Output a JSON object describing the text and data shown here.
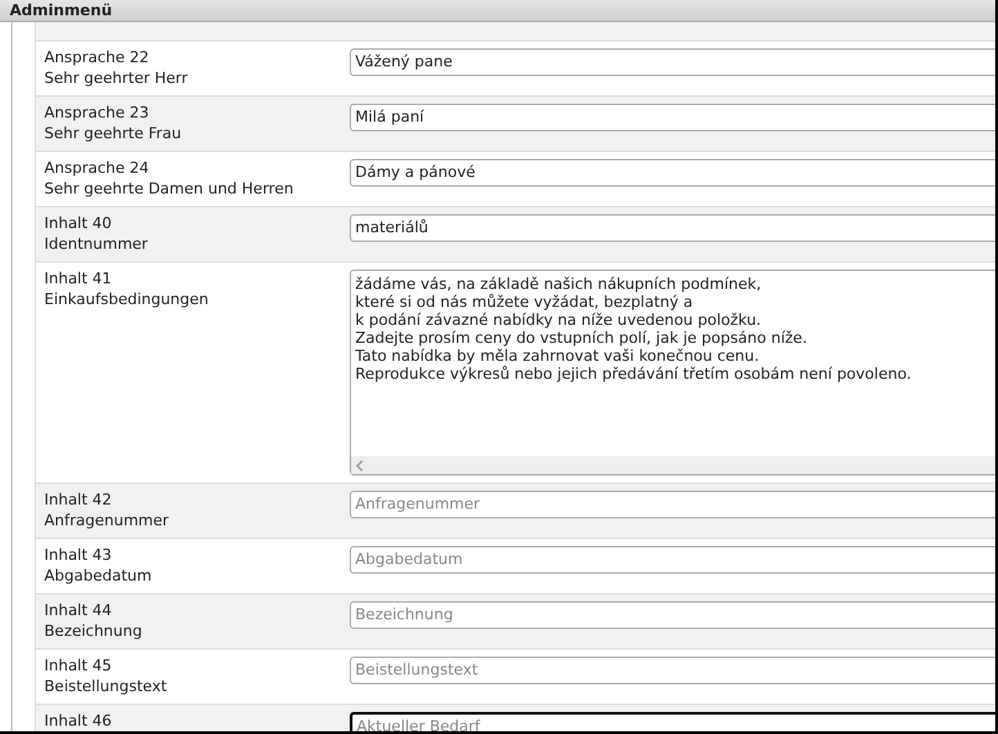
{
  "header": {
    "title": "Adminmenü"
  },
  "rows": [
    {
      "kind": "partial"
    },
    {
      "kind": "input",
      "label": "Ansprache 22",
      "description": "Sehr geehrter Herr",
      "value": "Vážený pane",
      "focused": false
    },
    {
      "kind": "input",
      "label": "Ansprache 23",
      "description": "Sehr geehrte Frau",
      "value": "Milá paní",
      "focused": false
    },
    {
      "kind": "input",
      "label": "Ansprache 24",
      "description": "Sehr geehrte Damen und Herren",
      "value": "Dámy a pánové",
      "focused": false
    },
    {
      "kind": "input",
      "label": "Inhalt 40",
      "description": "Identnummer",
      "value": "materiálů",
      "focused": false
    },
    {
      "kind": "textarea",
      "label": "Inhalt 41",
      "description": "Einkaufsbedingungen",
      "value": "žádáme vás, na základě našich nákupních podmínek,\nkteré si od nás můžete vyžádat, bezplatný a\nk podání závazné nabídky na níže uvedenou položku.\nZadejte prosím ceny do vstupních polí, jak je popsáno níže.\nTato nabídka by měla zahrnovat vaši konečnou cenu.\nReprodukce výkresů nebo jejich předávání třetím osobám není povoleno.",
      "focused": false
    },
    {
      "kind": "input",
      "label": "Inhalt 42",
      "description": "Anfragenummer",
      "placeholder": "Anfragenummer",
      "focused": false
    },
    {
      "kind": "input",
      "label": "Inhalt 43",
      "description": "Abgabedatum",
      "placeholder": "Abgabedatum",
      "focused": false
    },
    {
      "kind": "input",
      "label": "Inhalt 44",
      "description": "Bezeichnung",
      "placeholder": "Bezeichnung",
      "focused": false
    },
    {
      "kind": "input",
      "label": "Inhalt 45",
      "description": "Beistellungstext",
      "placeholder": "Beistellungstext",
      "focused": false
    },
    {
      "kind": "input",
      "label": "Inhalt 46",
      "placeholder": "Aktueller Bedarf",
      "focused": true
    }
  ]
}
